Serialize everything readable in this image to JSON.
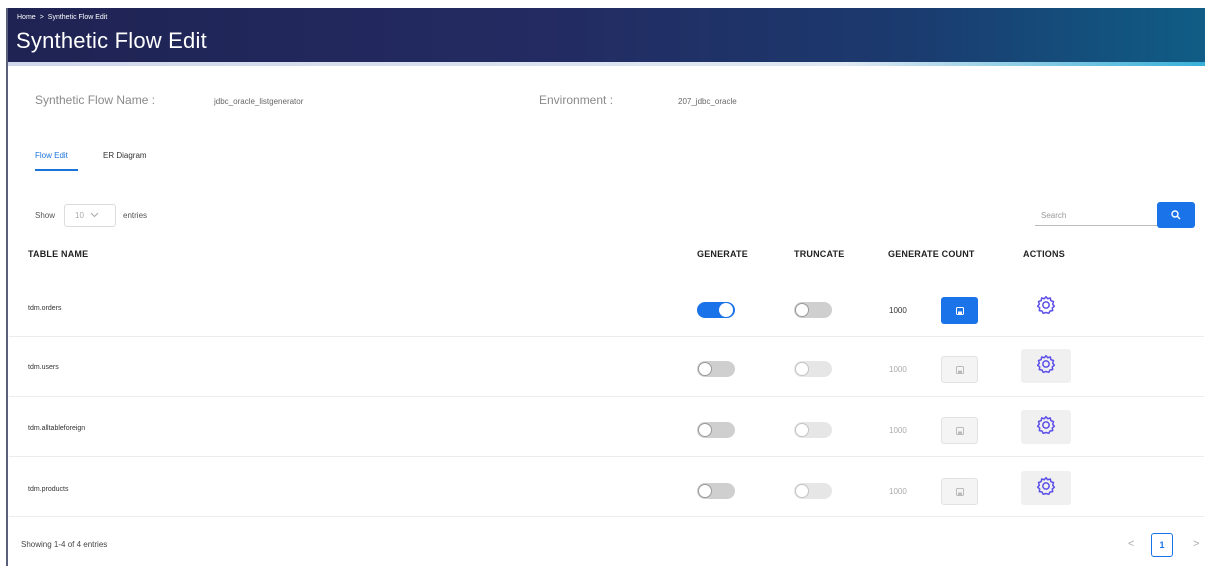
{
  "header": {
    "breadcrumb": [
      "Home",
      ">",
      "Synthetic Flow Edit"
    ],
    "title": "Synthetic Flow Edit"
  },
  "meta": {
    "flow_name_label": "Synthetic Flow Name :",
    "flow_name_value": "jdbc_oracle_listgenerator",
    "environment_label": "Environment :",
    "environment_value": "207_jdbc_oracle"
  },
  "tabs": [
    {
      "label": "Flow Edit",
      "active": true
    },
    {
      "label": "ER Diagram",
      "active": false
    }
  ],
  "table_controls": {
    "show_label": "Show",
    "page_size": "10",
    "entries_label": "entries",
    "search_placeholder": "Search"
  },
  "columns": {
    "table_name": "TABLE NAME",
    "generate": "GENERATE",
    "truncate": "TRUNCATE",
    "generate_count": "GENERATE COUNT",
    "actions": "ACTIONS"
  },
  "rows": [
    {
      "name": "tdm.orders",
      "generate": true,
      "truncate": false,
      "count": "1000",
      "enabled": true
    },
    {
      "name": "tdm.users",
      "generate": false,
      "truncate": false,
      "count": "1000",
      "enabled": false
    },
    {
      "name": "tdm.alltableforeign",
      "generate": false,
      "truncate": false,
      "count": "1000",
      "enabled": false
    },
    {
      "name": "tdm.products",
      "generate": false,
      "truncate": false,
      "count": "1000",
      "enabled": false
    }
  ],
  "footer": {
    "summary": "Showing 1-4 of 4 entries",
    "current_page": "1",
    "prev": "<",
    "next": ">"
  },
  "colors": {
    "header_dark": "#1f2353",
    "accent_blue": "#1a73e8",
    "gear_purple": "#5b4ee8"
  },
  "icons": {
    "search": "search-icon",
    "save": "save-icon",
    "settings": "gear-icon",
    "dropdown": "chevron-down-icon"
  }
}
